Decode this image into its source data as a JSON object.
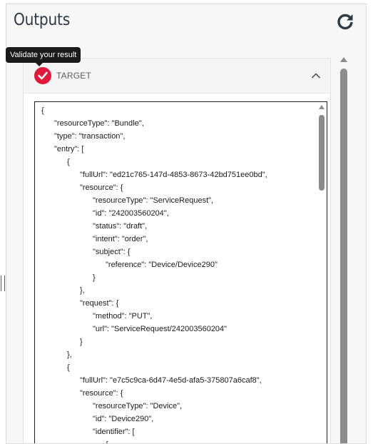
{
  "panel": {
    "title": "Outputs",
    "refresh_icon": "refresh-icon"
  },
  "tooltip": {
    "text": "Validate your result"
  },
  "target": {
    "title": "TARGET",
    "status_icon": "check-icon",
    "status_color": "#e0183c",
    "collapse_icon": "chevron-up-icon"
  },
  "code": {
    "lines": [
      "{",
      "    \"resourceType\": \"Bundle\",",
      "    \"type\": \"transaction\",",
      "    \"entry\": [",
      "        {",
      "            \"fullUrl\": \"ed21c765-147d-4853-8673-42bd751ee0bd\",",
      "            \"resource\": {",
      "                \"resourceType\": \"ServiceRequest\",",
      "                \"id\": \"242003560204\",",
      "                \"status\": \"draft\",",
      "                \"intent\": \"order\",",
      "                \"subject\": {",
      "                    \"reference\": \"Device/Device290\"",
      "                }",
      "            },",
      "            \"request\": {",
      "                \"method\": \"PUT\",",
      "                \"url\": \"ServiceRequest/242003560204\"",
      "            }",
      "        },",
      "        {",
      "            \"fullUrl\": \"e7c5c9ca-6d47-4e5d-afa5-375807a6caf8\",",
      "            \"resource\": {",
      "                \"resourceType\": \"Device\",",
      "                \"id\": \"Device290\",",
      "                \"identifier\": [",
      "                    {"
    ]
  }
}
